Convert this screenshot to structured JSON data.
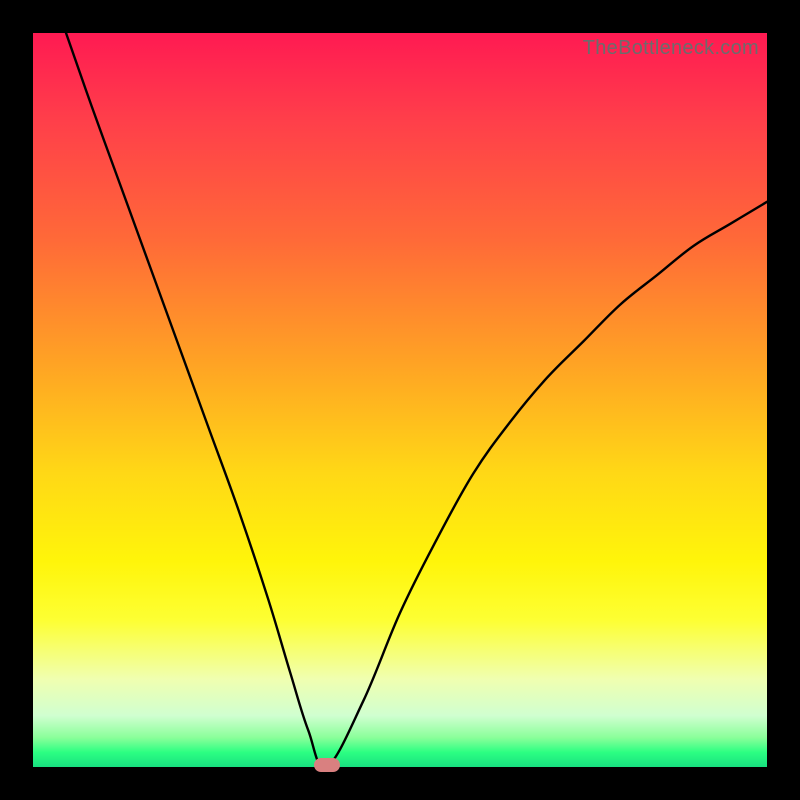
{
  "watermark": "TheBottleneck.com",
  "colors": {
    "frame": "#000000",
    "curve": "#000000",
    "marker": "#d98080",
    "gradient_top": "#ff1a52",
    "gradient_bottom": "#18e080"
  },
  "chart_data": {
    "type": "line",
    "title": "",
    "xlabel": "",
    "ylabel": "",
    "xlim": [
      0,
      100
    ],
    "ylim": [
      0,
      100
    ],
    "x": [
      4.5,
      8,
      12,
      16,
      20,
      24,
      28,
      32,
      35,
      37.5,
      40,
      45,
      50,
      55,
      60,
      65,
      70,
      75,
      80,
      85,
      90,
      95,
      100
    ],
    "values": [
      100,
      90,
      79,
      68,
      57,
      46,
      35,
      23,
      13,
      5,
      0,
      9,
      21,
      31,
      40,
      47,
      53,
      58,
      63,
      67,
      71,
      74,
      77
    ],
    "marker": {
      "x": 40,
      "y": 0
    },
    "annotations": [
      "TheBottleneck.com"
    ]
  }
}
